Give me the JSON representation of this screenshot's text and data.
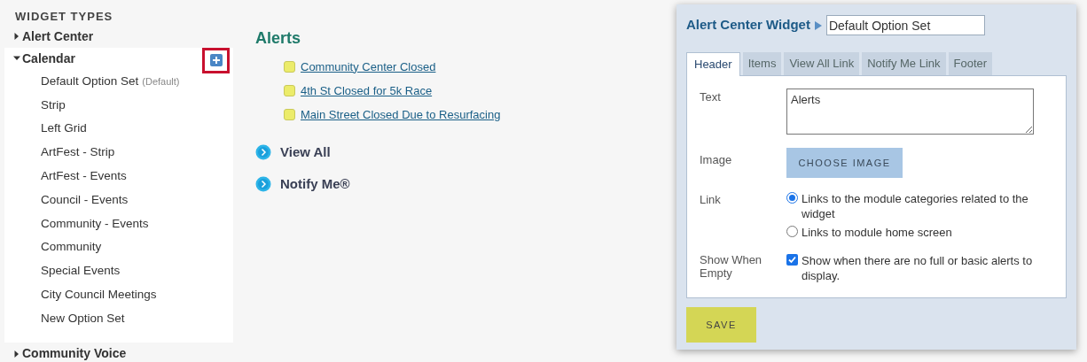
{
  "sidebar": {
    "title": "WIDGET TYPES",
    "items": [
      {
        "label": "Alert Center",
        "expanded": false
      },
      {
        "label": "Calendar",
        "expanded": true,
        "add_highlighted": true,
        "children": [
          {
            "label": "Default Option Set",
            "tag": "(Default)"
          },
          {
            "label": "Strip"
          },
          {
            "label": "Left Grid"
          },
          {
            "label": "ArtFest - Strip"
          },
          {
            "label": "ArtFest - Events"
          },
          {
            "label": "Council - Events"
          },
          {
            "label": "Community - Events"
          },
          {
            "label": "Community"
          },
          {
            "label": "Special Events"
          },
          {
            "label": "City Council Meetings"
          },
          {
            "label": "New Option Set"
          }
        ]
      },
      {
        "label": "Community Voice",
        "expanded": false
      }
    ]
  },
  "preview": {
    "title": "Alerts",
    "alerts": [
      "Community Center Closed",
      "4th St Closed for 5k Race",
      "Main Street Closed Due to Resurfacing"
    ],
    "links": [
      "View All",
      "Notify Me®"
    ]
  },
  "editor": {
    "title": "Alert Center Widget",
    "name_value": "Default Option Set",
    "tabs": [
      {
        "label": "Header",
        "selected": true
      },
      {
        "label": "Items",
        "selected": false
      },
      {
        "label": "View All Link",
        "selected": false
      },
      {
        "label": "Notify Me Link",
        "selected": false
      },
      {
        "label": "Footer",
        "selected": false
      }
    ],
    "text_label": "Text",
    "text_value": "Alerts",
    "image_label": "Image",
    "image_button": "CHOOSE IMAGE",
    "link_label": "Link",
    "link_options": [
      {
        "label": "Links to the module categories related to the widget",
        "selected": true
      },
      {
        "label": "Links to module home screen",
        "selected": false
      }
    ],
    "empty_label": "Show When Empty",
    "empty_option": {
      "label": "Show when there are no full or basic alerts to display.",
      "checked": true
    },
    "save": "SAVE"
  }
}
